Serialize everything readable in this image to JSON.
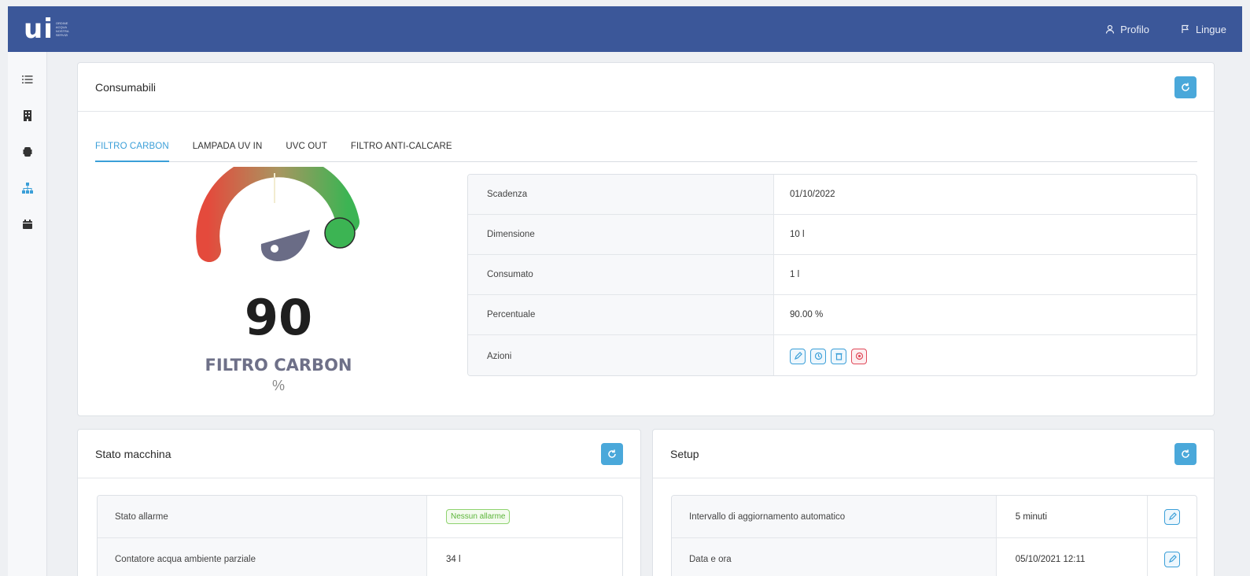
{
  "topbar": {
    "logo_text": "ui",
    "logo_sub": [
      "ORDINE",
      "ACQUA",
      "NOSTRA",
      "SERVIZI"
    ],
    "profile_label": "Profilo",
    "language_label": "Lingue"
  },
  "sidebar": {
    "items": [
      {
        "name": "list",
        "icon": "list-icon"
      },
      {
        "name": "building",
        "icon": "building-icon"
      },
      {
        "name": "device",
        "icon": "device-icon"
      },
      {
        "name": "network",
        "icon": "network-icon",
        "active": true
      },
      {
        "name": "calendar",
        "icon": "calendar-icon"
      }
    ]
  },
  "consumabili": {
    "title": "Consumabili",
    "tabs": [
      "FILTRO CARBON",
      "LAMPADA UV IN",
      "UVC OUT",
      "FILTRO ANTI-CALCARE"
    ],
    "active_tab": 0,
    "gauge": {
      "value": "90",
      "level": 0.9,
      "label": "FILTRO CARBON",
      "unit": "%"
    },
    "info": {
      "rows": [
        {
          "key": "Scadenza",
          "value": "01/10/2022"
        },
        {
          "key": "Dimensione",
          "value": "10 l"
        },
        {
          "key": "Consumato",
          "value": "1 l"
        },
        {
          "key": "Percentuale",
          "value": "90.00 %"
        },
        {
          "key": "Azioni",
          "value": ""
        }
      ]
    },
    "actions": [
      "edit-icon",
      "reset-icon",
      "delete-icon",
      "stop-icon"
    ]
  },
  "stato": {
    "title": "Stato macchina",
    "rows": [
      {
        "key": "Stato allarme",
        "value": "Nessun allarme"
      },
      {
        "key": "Contatore acqua ambiente parziale",
        "value": "34 l"
      }
    ]
  },
  "setup": {
    "title": "Setup",
    "rows": [
      {
        "key": "Intervallo di aggiornamento automatico",
        "value": "5 minuti"
      },
      {
        "key": "Data e ora",
        "value": "05/10/2021 12:11"
      }
    ]
  },
  "colors": {
    "topbar": "#3b5799",
    "accent": "#3b9fd8",
    "danger": "#e04a5a",
    "success": "#5cb53a"
  }
}
